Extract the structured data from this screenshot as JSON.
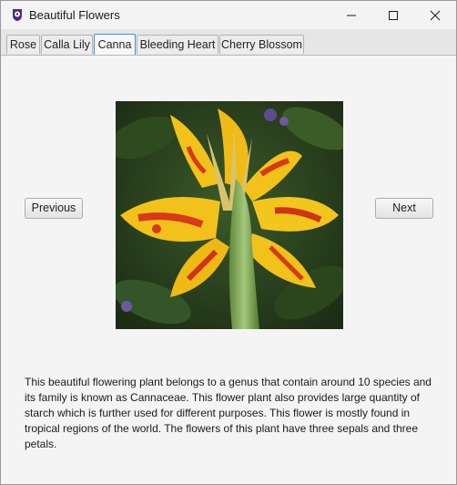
{
  "window": {
    "title": "Beautiful Flowers",
    "app_icon": "flower-app-icon",
    "controls": [
      "minimize-icon",
      "maximize-icon",
      "close-icon"
    ]
  },
  "tabs": [
    {
      "label": "Rose",
      "active": false
    },
    {
      "label": "Calla Lily",
      "active": false
    },
    {
      "label": "Canna",
      "active": true
    },
    {
      "label": "Bleeding Heart",
      "active": false
    },
    {
      "label": "Cherry Blossom",
      "active": false
    }
  ],
  "main": {
    "previous_label": "Previous",
    "next_label": "Next",
    "description": "This beautiful flowering plant belongs to a genus that contain around 10 species and its family is known as Cannaceae. This flower plant also provides large quantity of starch which is further used for different purposes. This flower is mostly found in tropical regions of the world. The flowers of this plant have three sepals and three petals."
  },
  "colors": {
    "active_tab_border": "#3f8fd6",
    "petal_yellow": "#f2c21a",
    "petal_red": "#d8391a",
    "foliage_green": "#2f4a22"
  }
}
